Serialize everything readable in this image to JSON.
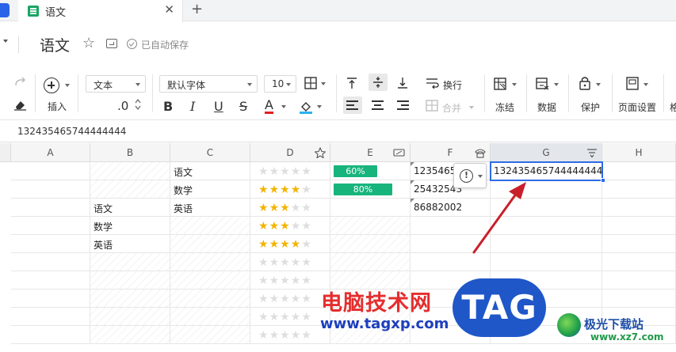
{
  "tabbar": {
    "doc_tab": "语文",
    "close_glyph": "✕",
    "add_glyph": "+"
  },
  "titlerow": {
    "title": "语文",
    "save_status": "已自动保存"
  },
  "toolbar": {
    "insert_label": "插入",
    "format_select": "文本",
    "decimal_label": ".0",
    "font_select": "默认字体",
    "size_select": "10",
    "bold": "B",
    "italic": "I",
    "underline": "U",
    "strike": "S",
    "font_color": "A",
    "wrap_label": "换行",
    "merge_label": "合并",
    "freeze_label": "冻结",
    "data_label": "数据",
    "protect_label": "保护",
    "page_setup_label": "页面设置",
    "more_label": "格"
  },
  "formula_bar": {
    "value": "132435465744444444"
  },
  "grid": {
    "columns": [
      "A",
      "B",
      "C",
      "D",
      "E",
      "F",
      "G",
      "H"
    ],
    "selected_column": "G",
    "rows": [
      {
        "A": "",
        "B": "",
        "C": "语文",
        "D_stars": 0,
        "E_progress": 60,
        "E_label": "60%",
        "F": "1235465",
        "G": "132435465744444444"
      },
      {
        "A": "",
        "B": "",
        "C": "数学",
        "D_stars": 4,
        "E_progress": 80,
        "E_label": "80%",
        "F": "25432543",
        "G": ""
      },
      {
        "A": "",
        "B": "语文",
        "C": "英语",
        "D_stars": 3,
        "E_progress": null,
        "E_label": "",
        "F": "86882002",
        "G": ""
      },
      {
        "A": "",
        "B": "数学",
        "C": "",
        "D_stars": 3,
        "E_progress": null,
        "E_label": "",
        "F": "",
        "G": ""
      },
      {
        "A": "",
        "B": "英语",
        "C": "",
        "D_stars": 4,
        "E_progress": null,
        "E_label": "",
        "F": "",
        "G": ""
      },
      {
        "A": "",
        "B": "",
        "C": "",
        "D_stars": 0,
        "E_progress": null,
        "E_label": "",
        "F": "",
        "G": ""
      },
      {
        "A": "",
        "B": "",
        "C": "",
        "D_stars": 0,
        "E_progress": null,
        "E_label": "",
        "F": "",
        "G": ""
      },
      {
        "A": "",
        "B": "",
        "C": "",
        "D_stars": 0,
        "E_progress": null,
        "E_label": "",
        "F": "",
        "G": ""
      },
      {
        "A": "",
        "B": "",
        "C": "",
        "D_stars": 0,
        "E_progress": null,
        "E_label": "",
        "F": "",
        "G": ""
      },
      {
        "A": "",
        "B": "",
        "C": "",
        "D_stars": 0,
        "E_progress": null,
        "E_label": "",
        "F": "",
        "G": ""
      }
    ],
    "warning_glyph": "!"
  },
  "overlay": {
    "brand_cn": "电脑技术网",
    "brand_url": "www.tagxp.com",
    "tag_badge": "TAG",
    "brand_site_cn": "极光下载站",
    "brand_site_url": "www.xz7.com"
  },
  "colors": {
    "accent": "#2e6be6",
    "progress": "#17b47c",
    "star": "#f2b400",
    "arrow": "#c8202a"
  }
}
